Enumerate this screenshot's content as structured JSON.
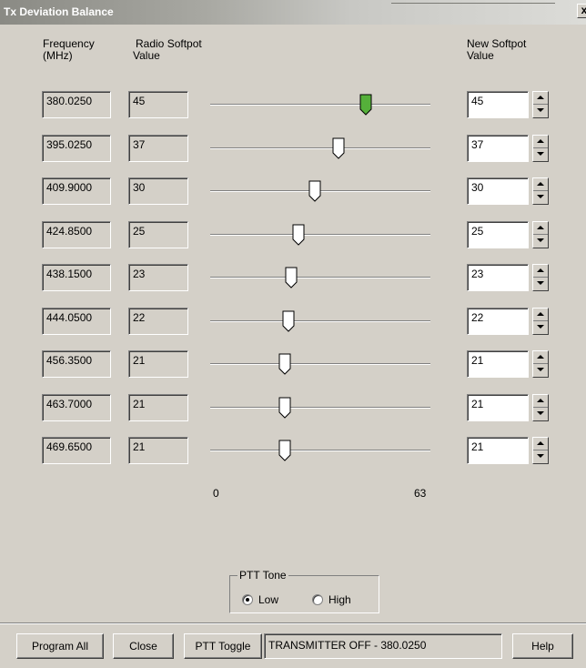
{
  "window": {
    "title": "Tx Deviation Balance",
    "close_glyph": "x"
  },
  "headers": {
    "frequency": [
      "Frequency",
      "(MHz)"
    ],
    "radio_softpot": [
      "Radio Softpot",
      "Value"
    ],
    "new_softpot": [
      "New Softpot",
      "Value"
    ]
  },
  "slider": {
    "min_label": "0",
    "max_label": "63",
    "min": 0,
    "max": 63
  },
  "rows": [
    {
      "frequency": "380.0250",
      "radio_value": "45",
      "new_value": "45",
      "selected": true
    },
    {
      "frequency": "395.0250",
      "radio_value": "37",
      "new_value": "37",
      "selected": false
    },
    {
      "frequency": "409.9000",
      "radio_value": "30",
      "new_value": "30",
      "selected": false
    },
    {
      "frequency": "424.8500",
      "radio_value": "25",
      "new_value": "25",
      "selected": false
    },
    {
      "frequency": "438.1500",
      "radio_value": "23",
      "new_value": "23",
      "selected": false
    },
    {
      "frequency": "444.0500",
      "radio_value": "22",
      "new_value": "22",
      "selected": false
    },
    {
      "frequency": "456.3500",
      "radio_value": "21",
      "new_value": "21",
      "selected": false
    },
    {
      "frequency": "463.7000",
      "radio_value": "21",
      "new_value": "21",
      "selected": false
    },
    {
      "frequency": "469.6500",
      "radio_value": "21",
      "new_value": "21",
      "selected": false
    }
  ],
  "ptt_tone": {
    "legend": "PTT Tone",
    "options": [
      {
        "label": "Low",
        "checked": true
      },
      {
        "label": "High",
        "checked": false
      }
    ]
  },
  "buttons": {
    "program_all": "Program All",
    "close": "Close",
    "ptt_toggle": "PTT Toggle",
    "help": "Help"
  },
  "status": "TRANSMITTER OFF - 380.0250",
  "colors": {
    "selected_thumb": "#55b03a",
    "thumb": "#ffffff",
    "background": "#d4d0c8"
  }
}
